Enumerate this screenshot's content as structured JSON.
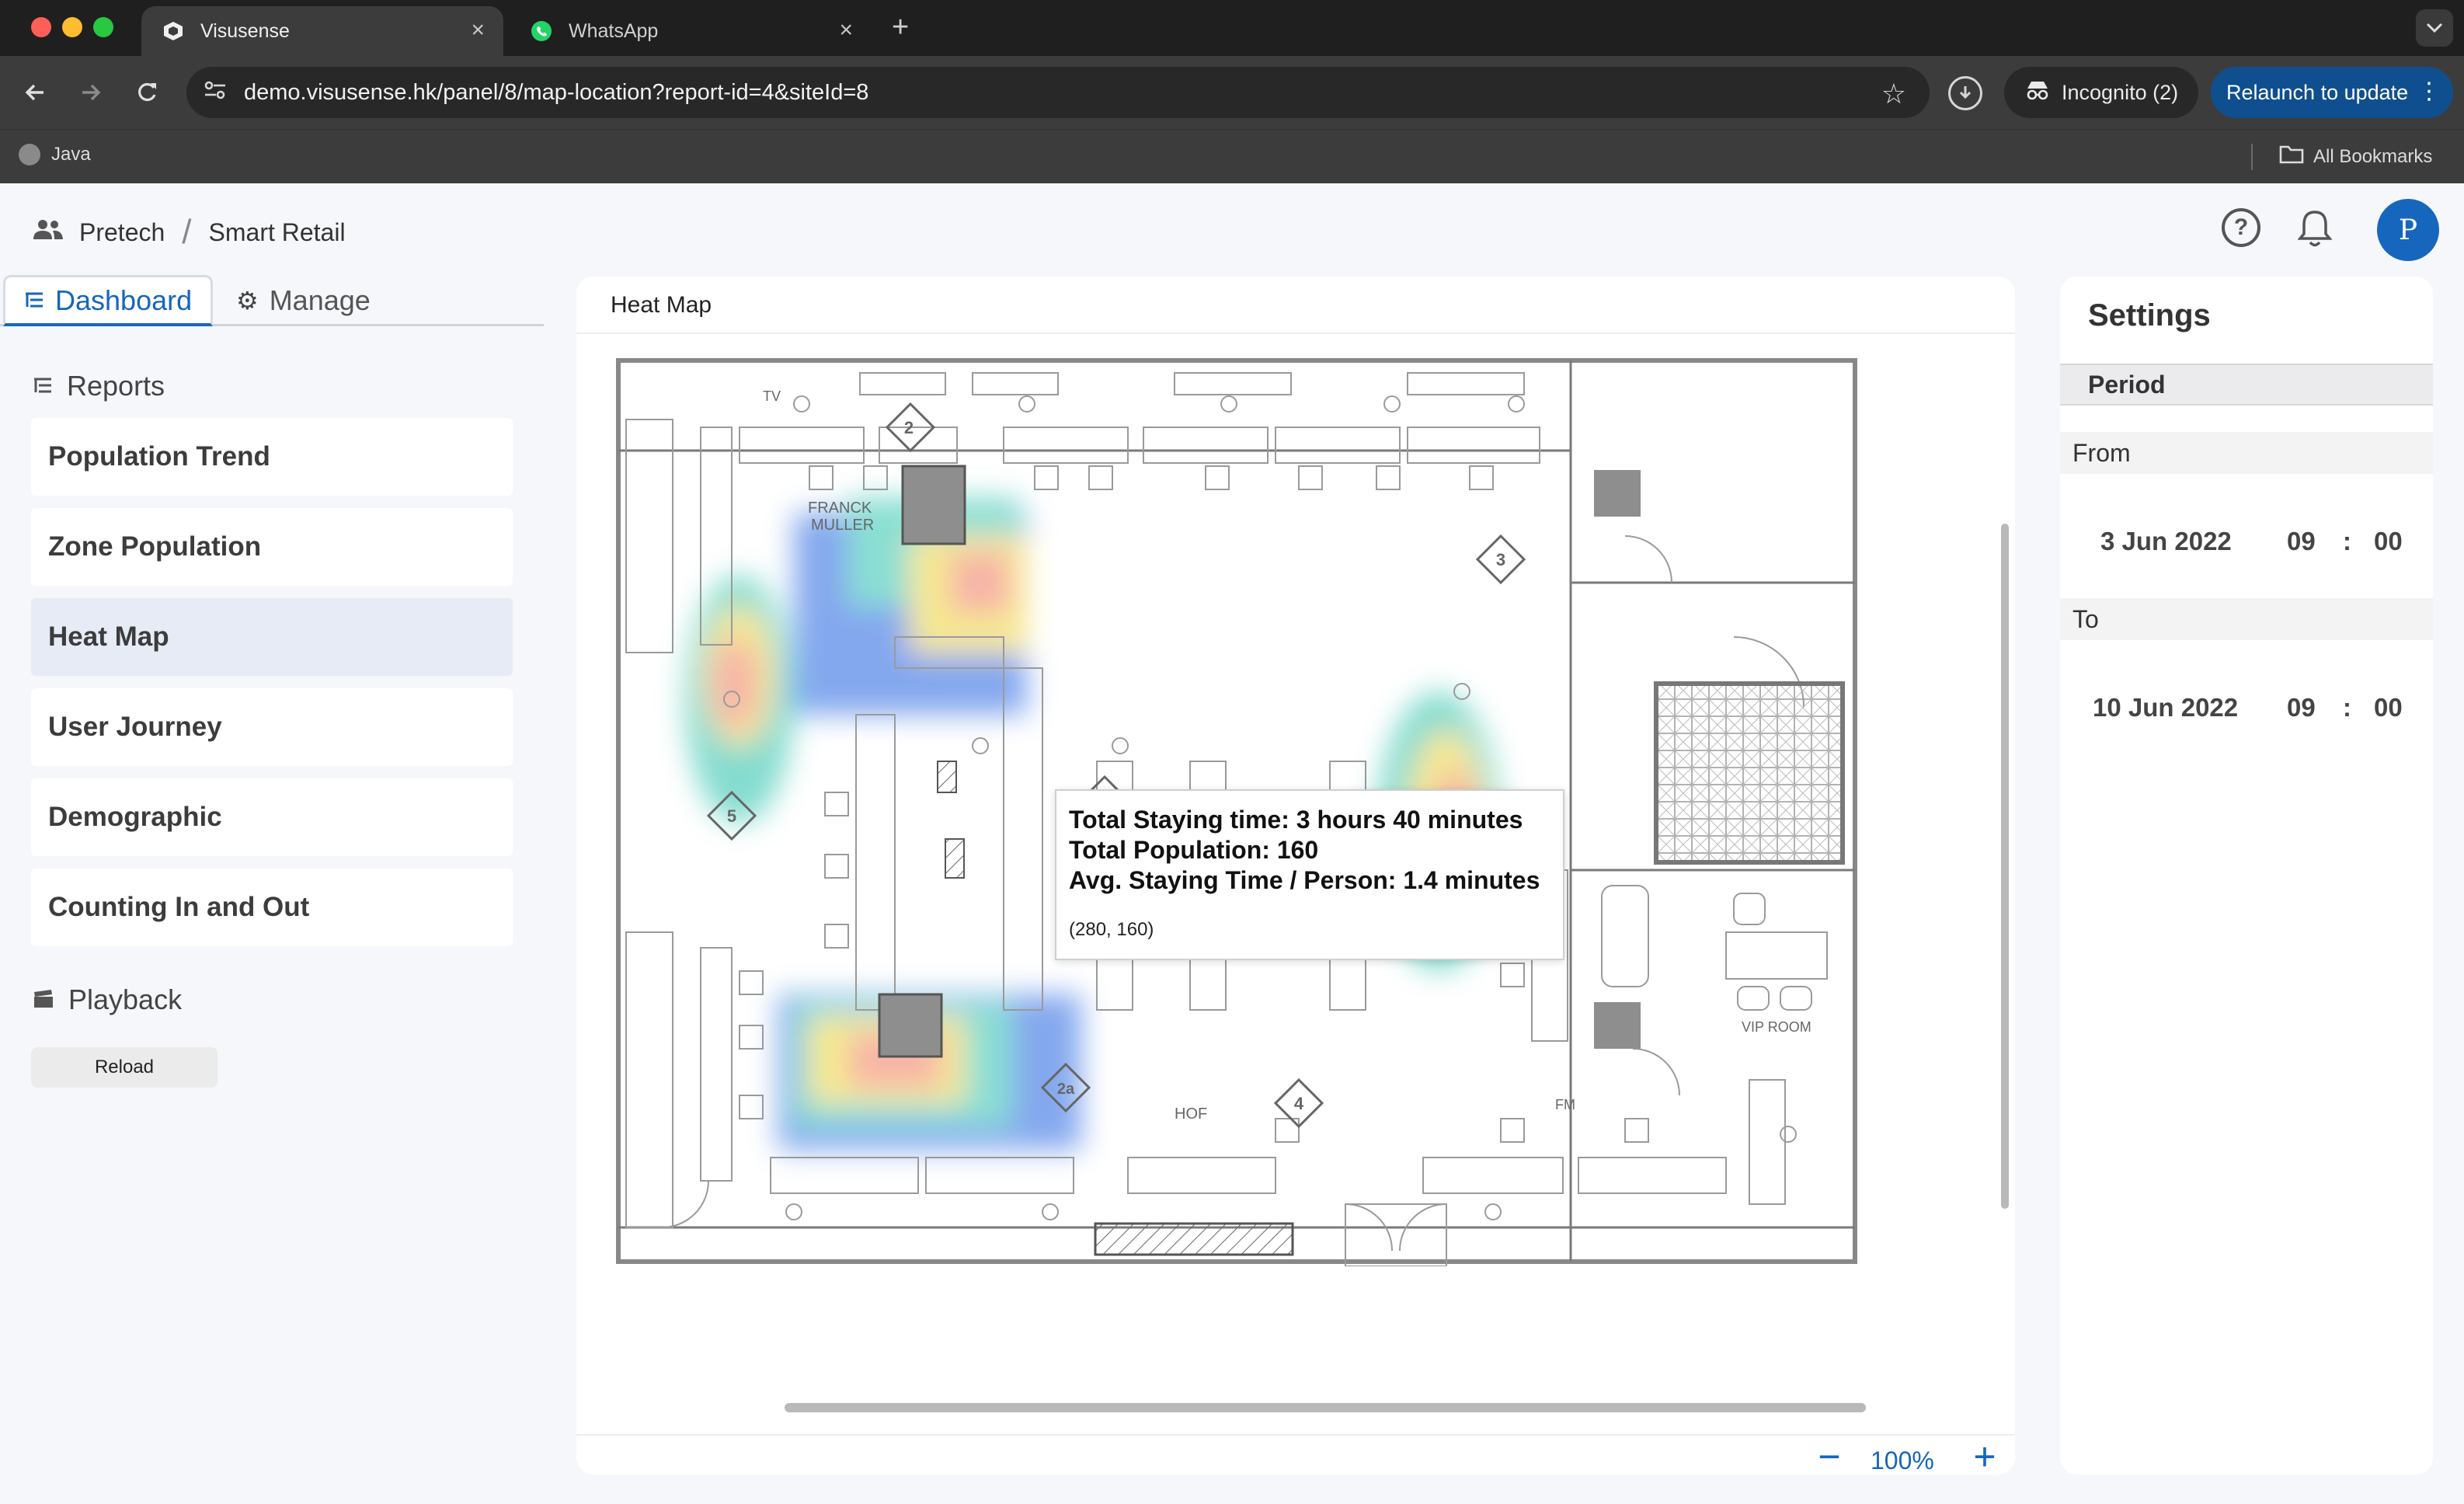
{
  "browser": {
    "tabs": [
      {
        "title": "Visusense",
        "close": "×"
      },
      {
        "title": "WhatsApp",
        "close": "×"
      }
    ],
    "new_tab": "+",
    "url": "demo.visusense.hk/panel/8/map-location?report-id=4&siteId=8",
    "incognito_label": "Incognito (2)",
    "relaunch_label": "Relaunch to update",
    "bookmarks": [
      {
        "label": "Java"
      }
    ],
    "all_bookmarks": "All Bookmarks",
    "colors": {
      "tabbar": "#1f1f1f",
      "toolbar": "#3c3c3c",
      "relaunch": "#0f4f8f"
    }
  },
  "header": {
    "breadcrumb": [
      "Pretech",
      "Smart Retail"
    ],
    "breadcrumb_sep": "/",
    "help": "?",
    "avatar_initial": "P",
    "accent": "#1666bd"
  },
  "sidebar": {
    "tabs": [
      {
        "label": "Dashboard",
        "active": true,
        "icon": "report-icon"
      },
      {
        "label": "Manage",
        "active": false,
        "icon": "gear-icon"
      }
    ],
    "reports_heading": "Reports",
    "reports": [
      {
        "label": "Population Trend"
      },
      {
        "label": "Zone Population"
      },
      {
        "label": "Heat Map",
        "active": true
      },
      {
        "label": "User Journey"
      },
      {
        "label": "Demographic"
      },
      {
        "label": "Counting In and Out"
      }
    ],
    "playback_heading": "Playback",
    "reload_label": "Reload"
  },
  "main": {
    "title": "Heat Map",
    "tooltip": {
      "staying_time": "Total Staying time: 3 hours 40 minutes",
      "population": "Total Population: 160",
      "avg_time": "Avg. Staying Time / Person: 1.4 minutes",
      "coordinate": "(280, 160)"
    },
    "zoom": {
      "out": "−",
      "level": "100%",
      "in": "+"
    }
  },
  "settings": {
    "title": "Settings",
    "period_label": "Period",
    "from": {
      "label": "From",
      "date": "3 Jun 2022",
      "hour": "09",
      "minute": "00"
    },
    "to": {
      "label": "To",
      "date": "10 Jun 2022",
      "hour": "09",
      "minute": "00"
    },
    "time_sep": ":"
  },
  "floorplan_labels": {
    "brand": [
      "FRANCK",
      "MULLER"
    ],
    "hof": "HOF",
    "vip": "VIP ROOM",
    "tv": "TV",
    "fm": "FM"
  }
}
